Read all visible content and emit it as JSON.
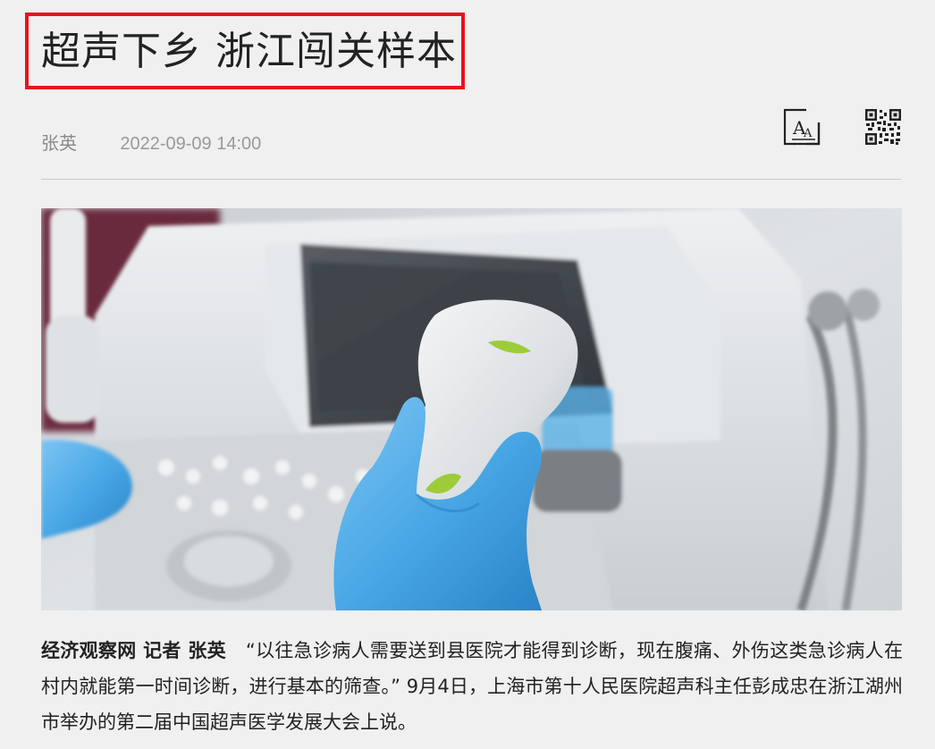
{
  "article": {
    "title": "超声下乡 浙江闯关样本",
    "author": "张英",
    "date": "2022-09-09 14:00",
    "byline": "经济观察网 记者 张英",
    "paragraph": "“以往急诊病人需要送到县医院才能得到诊断，现在腹痛、外伤这类急诊病人在村内就能第一时间诊断，进行基本的筛查。” 9月4日，上海市第十人民医院超声科主任彭成忠在浙江湖州市举办的第二届中国超声医学发展大会上说。"
  },
  "toolbar": {
    "font_size_icon": "font-size-icon",
    "qr_code_icon": "qr-code-icon"
  },
  "colors": {
    "highlight_border": "#e8121b",
    "glove": "#4aa8e6",
    "probe_accent": "#9ccc3a"
  }
}
